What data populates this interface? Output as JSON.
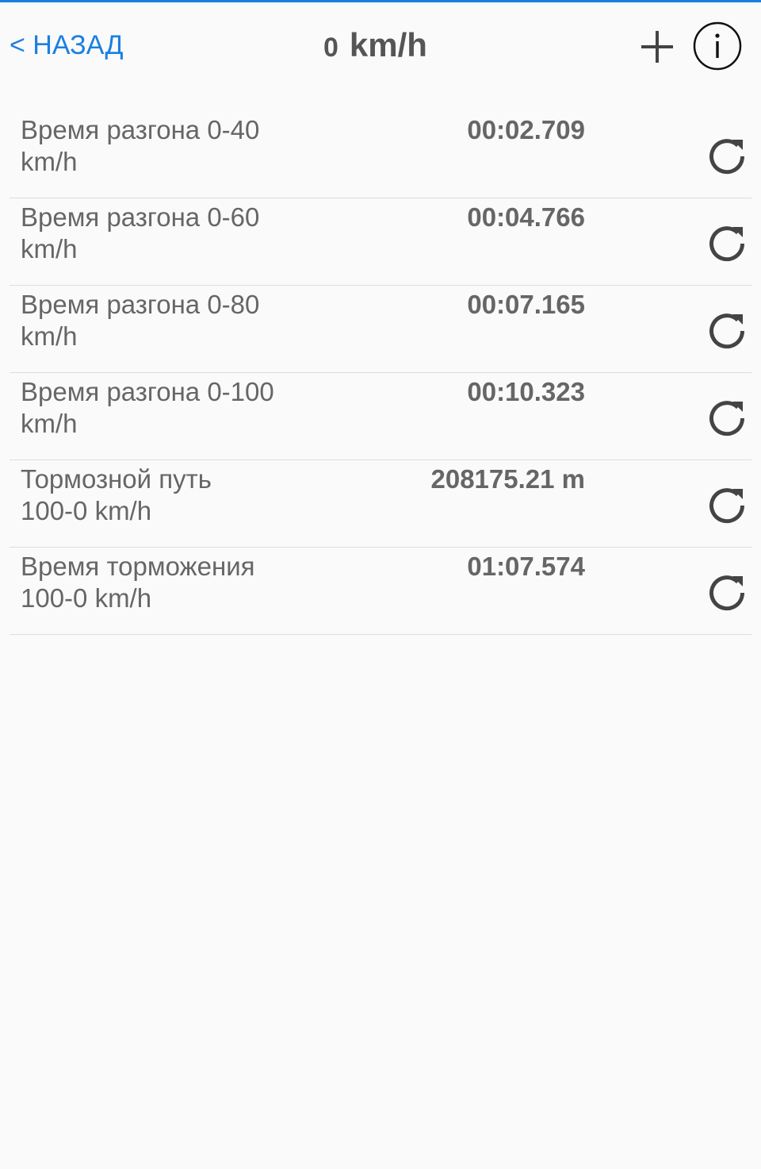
{
  "header": {
    "back_label": "< НАЗАД",
    "speed_value": "0",
    "speed_unit": "km/h",
    "add_icon": "plus-icon",
    "info_icon": "info-circle-icon"
  },
  "colors": {
    "accent": "#1a7fe0",
    "text": "#666666",
    "background": "#fafafa",
    "divider": "#dddddd"
  },
  "rows": [
    {
      "label": "Время разгона  0-40\nkm/h",
      "value": "00:02.709",
      "icon": "refresh-icon"
    },
    {
      "label": "Время разгона  0-60\nkm/h",
      "value": "00:04.766",
      "icon": "refresh-icon"
    },
    {
      "label": "Время разгона  0-80\nkm/h",
      "value": "00:07.165",
      "icon": "refresh-icon"
    },
    {
      "label": "Время разгона  0-100\nkm/h",
      "value": "00:10.323",
      "icon": "refresh-icon"
    },
    {
      "label": "Тормозной путь\n100-0 km/h",
      "value": "208175.21 m",
      "icon": "refresh-icon"
    },
    {
      "label": "Время торможения\n100-0 km/h",
      "value": "01:07.574",
      "icon": "refresh-icon"
    }
  ]
}
